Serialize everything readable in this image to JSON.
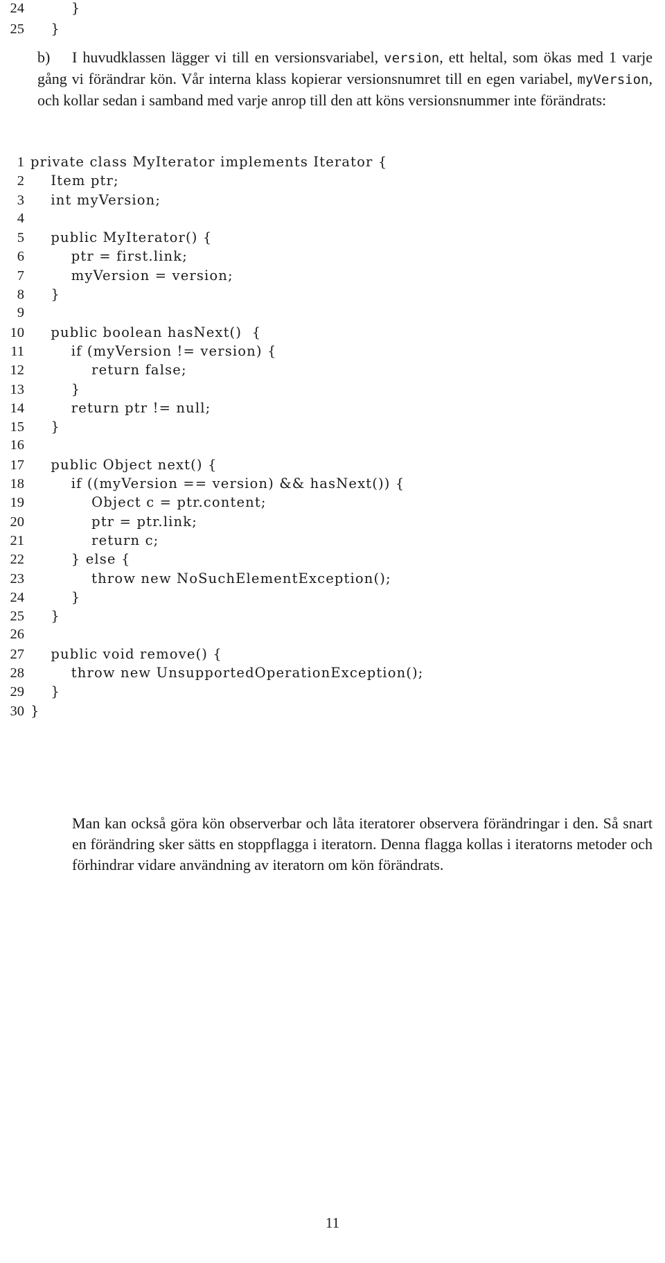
{
  "document": {
    "language": "sv",
    "page_number": "11"
  },
  "top_listing": {
    "lines": [
      {
        "no": "24",
        "code": "        }"
      },
      {
        "no": "25",
        "code": "    }"
      }
    ]
  },
  "item_b": {
    "label": "b)",
    "lines": [
      "I huvudklassen lägger vi till en versionsvariabel, ",
      ", ett heltal, som ökas med 1 varje gång vi förändrar kön. Vår interna klass kopierar versionsnumret till en egen variabel, ",
      ", och kollar sedan i samband med varje anrop till den att köns versionsnummer inte förändrats:"
    ],
    "inline_code_1": "version",
    "inline_code_2": "myVersion",
    "full_text": "I huvudklassen lägger vi till en versionsvariabel, version, ett heltal, som ökas med 1 varje gång vi förändrar kön. Vår interna klass kopierar versionsnumret till en egen variabel, myVersion, och kollar sedan i samband med varje anrop till den att köns versionsnummer inte förändrats:"
  },
  "code_listing": {
    "language": "Java",
    "lines": [
      {
        "no": "1",
        "code": "private class MyIterator implements Iterator {"
      },
      {
        "no": "2",
        "code": "    Item ptr;"
      },
      {
        "no": "3",
        "code": "    int myVersion;"
      },
      {
        "no": "4",
        "code": ""
      },
      {
        "no": "5",
        "code": "    public MyIterator() {"
      },
      {
        "no": "6",
        "code": "        ptr = first.link;"
      },
      {
        "no": "7",
        "code": "        myVersion = version;"
      },
      {
        "no": "8",
        "code": "    }"
      },
      {
        "no": "9",
        "code": ""
      },
      {
        "no": "10",
        "code": "    public boolean hasNext()  {"
      },
      {
        "no": "11",
        "code": "        if (myVersion != version) {"
      },
      {
        "no": "12",
        "code": "            return false;"
      },
      {
        "no": "13",
        "code": "        }"
      },
      {
        "no": "14",
        "code": "        return ptr != null;"
      },
      {
        "no": "15",
        "code": "    }"
      },
      {
        "no": "16",
        "code": ""
      },
      {
        "no": "17",
        "code": "    public Object next() {"
      },
      {
        "no": "18",
        "code": "        if ((myVersion == version) && hasNext()) {"
      },
      {
        "no": "19",
        "code": "            Object c = ptr.content;"
      },
      {
        "no": "20",
        "code": "            ptr = ptr.link;"
      },
      {
        "no": "21",
        "code": "            return c;"
      },
      {
        "no": "22",
        "code": "        } else {"
      },
      {
        "no": "23",
        "code": "            throw new NoSuchElementException();"
      },
      {
        "no": "24",
        "code": "        }"
      },
      {
        "no": "25",
        "code": "    }"
      },
      {
        "no": "26",
        "code": ""
      },
      {
        "no": "27",
        "code": "    public void remove() {"
      },
      {
        "no": "28",
        "code": "        throw new UnsupportedOperationException();"
      },
      {
        "no": "29",
        "code": "    }"
      },
      {
        "no": "30",
        "code": "}"
      }
    ]
  },
  "closing_paragraph": {
    "text": "Man kan också göra kön observerbar och låta iteratorer observera förändringar i den. Så snart en förändring sker sätts en stoppflagga i iteratorn. Denna flagga kollas i iteratorns metoder och förhindrar vidare användning av iteratorn om kön förändrats."
  }
}
